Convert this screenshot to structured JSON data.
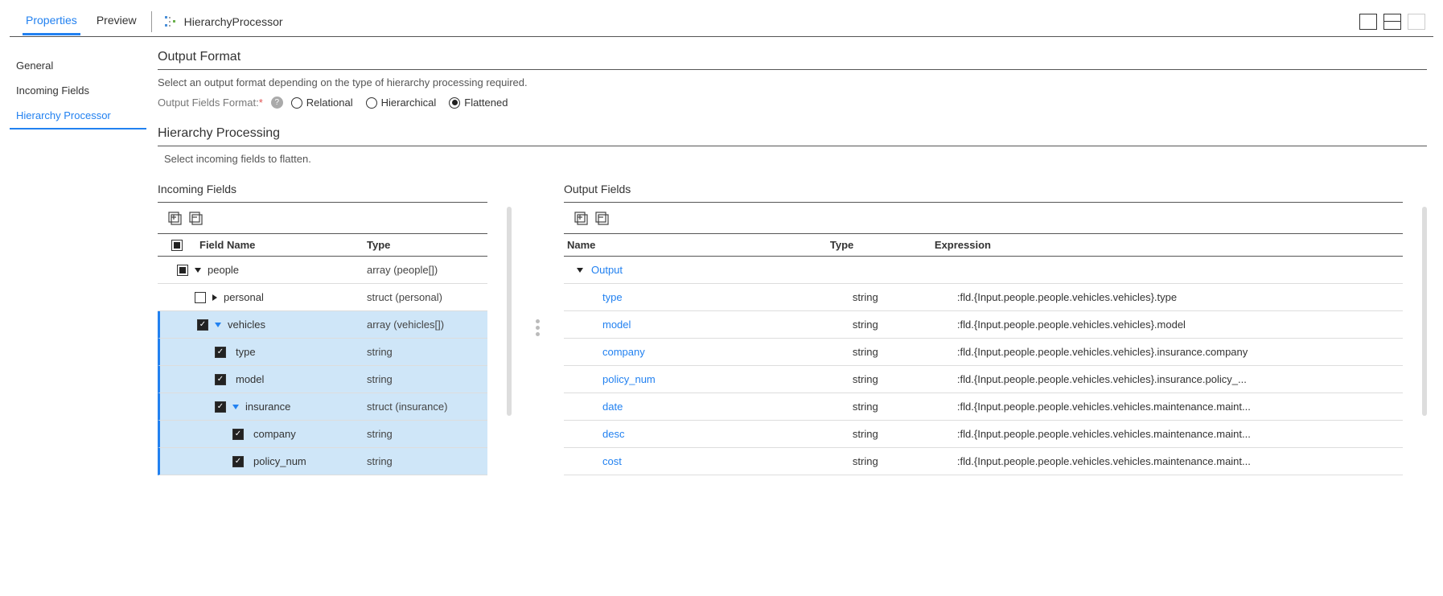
{
  "header": {
    "tabs": {
      "properties": "Properties",
      "preview": "Preview"
    },
    "processor_name": "HierarchyProcessor"
  },
  "sidebar": {
    "items": [
      "General",
      "Incoming Fields",
      "Hierarchy Processor"
    ]
  },
  "output_format": {
    "title": "Output Format",
    "desc": "Select an output format depending on the type of hierarchy processing required.",
    "label": "Output Fields Format:",
    "options": {
      "relational": "Relational",
      "hierarchical": "Hierarchical",
      "flattened": "Flattened"
    }
  },
  "processing": {
    "title": "Hierarchy Processing",
    "desc": "Select incoming fields to flatten."
  },
  "incoming": {
    "title": "Incoming Fields",
    "headers": {
      "name": "Field Name",
      "type": "Type"
    },
    "rows": [
      {
        "name": "people",
        "type": "array (people[])",
        "indent": 0,
        "checked": "ind",
        "caret": "down-black",
        "sel": false
      },
      {
        "name": "personal",
        "type": "struct (personal)",
        "indent": 1,
        "checked": "none",
        "caret": "right",
        "sel": false
      },
      {
        "name": "vehicles",
        "type": "array (vehicles[])",
        "indent": 1,
        "checked": "checked",
        "caret": "down",
        "sel": true
      },
      {
        "name": "type",
        "type": "string",
        "indent": 2,
        "checked": "checked",
        "caret": "",
        "sel": true
      },
      {
        "name": "model",
        "type": "string",
        "indent": 2,
        "checked": "checked",
        "caret": "",
        "sel": true
      },
      {
        "name": "insurance",
        "type": "struct (insurance)",
        "indent": 2,
        "checked": "checked",
        "caret": "down",
        "sel": true
      },
      {
        "name": "company",
        "type": "string",
        "indent": 3,
        "checked": "checked",
        "caret": "",
        "sel": true
      },
      {
        "name": "policy_num",
        "type": "string",
        "indent": 3,
        "checked": "checked",
        "caret": "",
        "sel": true
      }
    ]
  },
  "output": {
    "title": "Output Fields",
    "headers": {
      "name": "Name",
      "type": "Type",
      "expr": "Expression"
    },
    "group": "Output",
    "rows": [
      {
        "name": "type",
        "type": "string",
        "expr": ":fld.{Input.people.people.vehicles.vehicles}.type"
      },
      {
        "name": "model",
        "type": "string",
        "expr": ":fld.{Input.people.people.vehicles.vehicles}.model"
      },
      {
        "name": "company",
        "type": "string",
        "expr": ":fld.{Input.people.people.vehicles.vehicles}.insurance.company"
      },
      {
        "name": "policy_num",
        "type": "string",
        "expr": ":fld.{Input.people.people.vehicles.vehicles}.insurance.policy_..."
      },
      {
        "name": "date",
        "type": "string",
        "expr": ":fld.{Input.people.people.vehicles.vehicles.maintenance.maint..."
      },
      {
        "name": "desc",
        "type": "string",
        "expr": ":fld.{Input.people.people.vehicles.vehicles.maintenance.maint..."
      },
      {
        "name": "cost",
        "type": "string",
        "expr": ":fld.{Input.people.people.vehicles.vehicles.maintenance.maint..."
      }
    ]
  }
}
